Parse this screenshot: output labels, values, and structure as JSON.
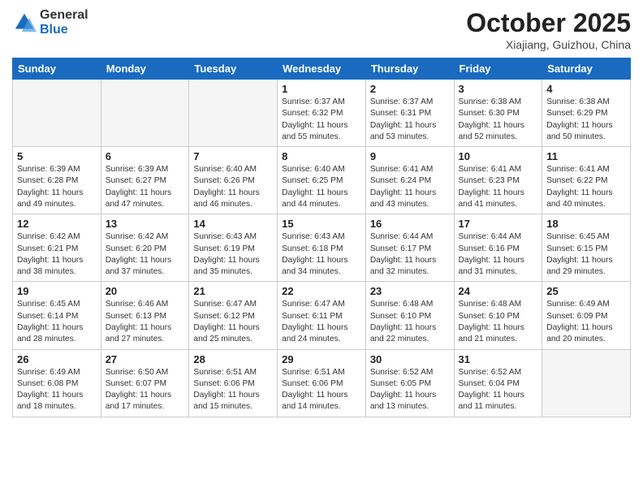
{
  "logo": {
    "general": "General",
    "blue": "Blue"
  },
  "title": "October 2025",
  "location": "Xiajiang, Guizhou, China",
  "days_of_week": [
    "Sunday",
    "Monday",
    "Tuesday",
    "Wednesday",
    "Thursday",
    "Friday",
    "Saturday"
  ],
  "weeks": [
    [
      {
        "day": "",
        "info": ""
      },
      {
        "day": "",
        "info": ""
      },
      {
        "day": "",
        "info": ""
      },
      {
        "day": "1",
        "info": "Sunrise: 6:37 AM\nSunset: 6:32 PM\nDaylight: 11 hours and 55 minutes."
      },
      {
        "day": "2",
        "info": "Sunrise: 6:37 AM\nSunset: 6:31 PM\nDaylight: 11 hours and 53 minutes."
      },
      {
        "day": "3",
        "info": "Sunrise: 6:38 AM\nSunset: 6:30 PM\nDaylight: 11 hours and 52 minutes."
      },
      {
        "day": "4",
        "info": "Sunrise: 6:38 AM\nSunset: 6:29 PM\nDaylight: 11 hours and 50 minutes."
      }
    ],
    [
      {
        "day": "5",
        "info": "Sunrise: 6:39 AM\nSunset: 6:28 PM\nDaylight: 11 hours and 49 minutes."
      },
      {
        "day": "6",
        "info": "Sunrise: 6:39 AM\nSunset: 6:27 PM\nDaylight: 11 hours and 47 minutes."
      },
      {
        "day": "7",
        "info": "Sunrise: 6:40 AM\nSunset: 6:26 PM\nDaylight: 11 hours and 46 minutes."
      },
      {
        "day": "8",
        "info": "Sunrise: 6:40 AM\nSunset: 6:25 PM\nDaylight: 11 hours and 44 minutes."
      },
      {
        "day": "9",
        "info": "Sunrise: 6:41 AM\nSunset: 6:24 PM\nDaylight: 11 hours and 43 minutes."
      },
      {
        "day": "10",
        "info": "Sunrise: 6:41 AM\nSunset: 6:23 PM\nDaylight: 11 hours and 41 minutes."
      },
      {
        "day": "11",
        "info": "Sunrise: 6:41 AM\nSunset: 6:22 PM\nDaylight: 11 hours and 40 minutes."
      }
    ],
    [
      {
        "day": "12",
        "info": "Sunrise: 6:42 AM\nSunset: 6:21 PM\nDaylight: 11 hours and 38 minutes."
      },
      {
        "day": "13",
        "info": "Sunrise: 6:42 AM\nSunset: 6:20 PM\nDaylight: 11 hours and 37 minutes."
      },
      {
        "day": "14",
        "info": "Sunrise: 6:43 AM\nSunset: 6:19 PM\nDaylight: 11 hours and 35 minutes."
      },
      {
        "day": "15",
        "info": "Sunrise: 6:43 AM\nSunset: 6:18 PM\nDaylight: 11 hours and 34 minutes."
      },
      {
        "day": "16",
        "info": "Sunrise: 6:44 AM\nSunset: 6:17 PM\nDaylight: 11 hours and 32 minutes."
      },
      {
        "day": "17",
        "info": "Sunrise: 6:44 AM\nSunset: 6:16 PM\nDaylight: 11 hours and 31 minutes."
      },
      {
        "day": "18",
        "info": "Sunrise: 6:45 AM\nSunset: 6:15 PM\nDaylight: 11 hours and 29 minutes."
      }
    ],
    [
      {
        "day": "19",
        "info": "Sunrise: 6:45 AM\nSunset: 6:14 PM\nDaylight: 11 hours and 28 minutes."
      },
      {
        "day": "20",
        "info": "Sunrise: 6:46 AM\nSunset: 6:13 PM\nDaylight: 11 hours and 27 minutes."
      },
      {
        "day": "21",
        "info": "Sunrise: 6:47 AM\nSunset: 6:12 PM\nDaylight: 11 hours and 25 minutes."
      },
      {
        "day": "22",
        "info": "Sunrise: 6:47 AM\nSunset: 6:11 PM\nDaylight: 11 hours and 24 minutes."
      },
      {
        "day": "23",
        "info": "Sunrise: 6:48 AM\nSunset: 6:10 PM\nDaylight: 11 hours and 22 minutes."
      },
      {
        "day": "24",
        "info": "Sunrise: 6:48 AM\nSunset: 6:10 PM\nDaylight: 11 hours and 21 minutes."
      },
      {
        "day": "25",
        "info": "Sunrise: 6:49 AM\nSunset: 6:09 PM\nDaylight: 11 hours and 20 minutes."
      }
    ],
    [
      {
        "day": "26",
        "info": "Sunrise: 6:49 AM\nSunset: 6:08 PM\nDaylight: 11 hours and 18 minutes."
      },
      {
        "day": "27",
        "info": "Sunrise: 6:50 AM\nSunset: 6:07 PM\nDaylight: 11 hours and 17 minutes."
      },
      {
        "day": "28",
        "info": "Sunrise: 6:51 AM\nSunset: 6:06 PM\nDaylight: 11 hours and 15 minutes."
      },
      {
        "day": "29",
        "info": "Sunrise: 6:51 AM\nSunset: 6:06 PM\nDaylight: 11 hours and 14 minutes."
      },
      {
        "day": "30",
        "info": "Sunrise: 6:52 AM\nSunset: 6:05 PM\nDaylight: 11 hours and 13 minutes."
      },
      {
        "day": "31",
        "info": "Sunrise: 6:52 AM\nSunset: 6:04 PM\nDaylight: 11 hours and 11 minutes."
      },
      {
        "day": "",
        "info": ""
      }
    ]
  ]
}
